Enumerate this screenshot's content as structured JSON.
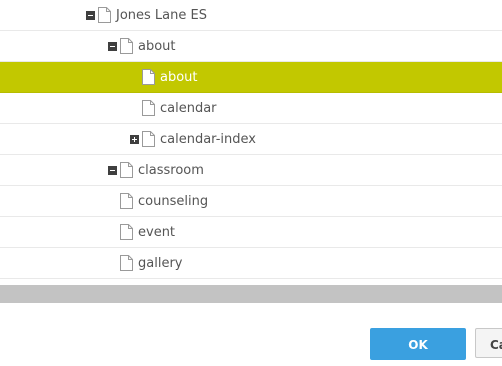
{
  "tree": {
    "items": [
      {
        "label": "Jones Lane ES",
        "depth": 0,
        "toggle": "collapse",
        "selected": false,
        "icon": "page-icon"
      },
      {
        "label": "about",
        "depth": 1,
        "toggle": "collapse",
        "selected": false,
        "icon": "page-icon"
      },
      {
        "label": "about",
        "depth": 2,
        "toggle": "",
        "selected": true,
        "icon": "page-icon"
      },
      {
        "label": "calendar",
        "depth": 2,
        "toggle": "",
        "selected": false,
        "icon": "page-icon"
      },
      {
        "label": "calendar-index",
        "depth": 2,
        "toggle": "expand",
        "selected": false,
        "icon": "page-icon"
      },
      {
        "label": "classroom",
        "depth": 1,
        "toggle": "collapse",
        "selected": false,
        "icon": "page-icon"
      },
      {
        "label": "counseling",
        "depth": 1,
        "toggle": "",
        "selected": false,
        "icon": "page-icon"
      },
      {
        "label": "event",
        "depth": 1,
        "toggle": "",
        "selected": false,
        "icon": "page-icon"
      },
      {
        "label": "gallery",
        "depth": 1,
        "toggle": "",
        "selected": false,
        "icon": "page-icon"
      }
    ]
  },
  "footer": {
    "ok_label": "OK",
    "cancel_label": "Cancel"
  },
  "colors": {
    "selected_row": "#c2c800",
    "ok_button": "#3aa0e0",
    "scrollbar": "#c3c3c3"
  }
}
